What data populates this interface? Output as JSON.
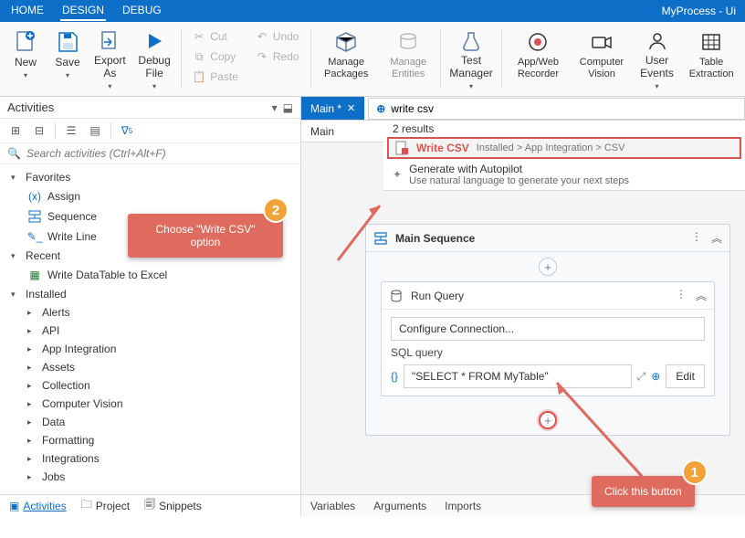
{
  "titlebar": {
    "tabs": [
      "HOME",
      "DESIGN",
      "DEBUG"
    ],
    "active": 1,
    "app": "MyProcess - Ui"
  },
  "ribbon": {
    "new": "New",
    "save": "Save",
    "export": "Export As",
    "debug": "Debug File",
    "cut": "Cut",
    "copy": "Copy",
    "paste": "Paste",
    "undo": "Undo",
    "redo": "Redo",
    "manage_packages": "Manage Packages",
    "manage_entities": "Manage Entities",
    "test_manager": "Test Manager",
    "app_recorder": "App/Web Recorder",
    "cv": "Computer Vision",
    "user_events": "User Events",
    "table_extraction": "Table Extraction"
  },
  "panel": {
    "title": "Activities",
    "search_ph": "Search activities (Ctrl+Alt+F)",
    "favorites": "Favorites",
    "fav_items": [
      "Assign",
      "Sequence",
      "Write Line"
    ],
    "recent": "Recent",
    "recent_items": [
      "Write DataTable to Excel"
    ],
    "installed": "Installed",
    "installed_items": [
      "Alerts",
      "API",
      "App Integration",
      "Assets",
      "Collection",
      "Computer Vision",
      "Data",
      "Formatting",
      "Integrations",
      "Jobs"
    ],
    "bottom": [
      "Activities",
      "Project",
      "Snippets"
    ]
  },
  "center": {
    "doctab": "Main *",
    "bread": "Main",
    "search_value": "write csv",
    "results_count": "2 results",
    "r1_label": "Write CSV",
    "r1_meta": "Installed > App Integration > CSV",
    "r2_label": "Generate with Autopilot",
    "r2_sub": "Use natural language to generate your next steps",
    "seq_title": "Main Sequence",
    "act_title": "Run Query",
    "cfg": "Configure Connection...",
    "qlabel": "SQL query",
    "qval": "\"SELECT * FROM MyTable\"",
    "edit": "Edit",
    "footer": [
      "Variables",
      "Arguments",
      "Imports"
    ]
  },
  "callouts": {
    "c1": {
      "num": "1",
      "text": "Click this button"
    },
    "c2": {
      "num": "2",
      "text1": "Choose \"Write CSV\"",
      "text2": "option"
    }
  }
}
